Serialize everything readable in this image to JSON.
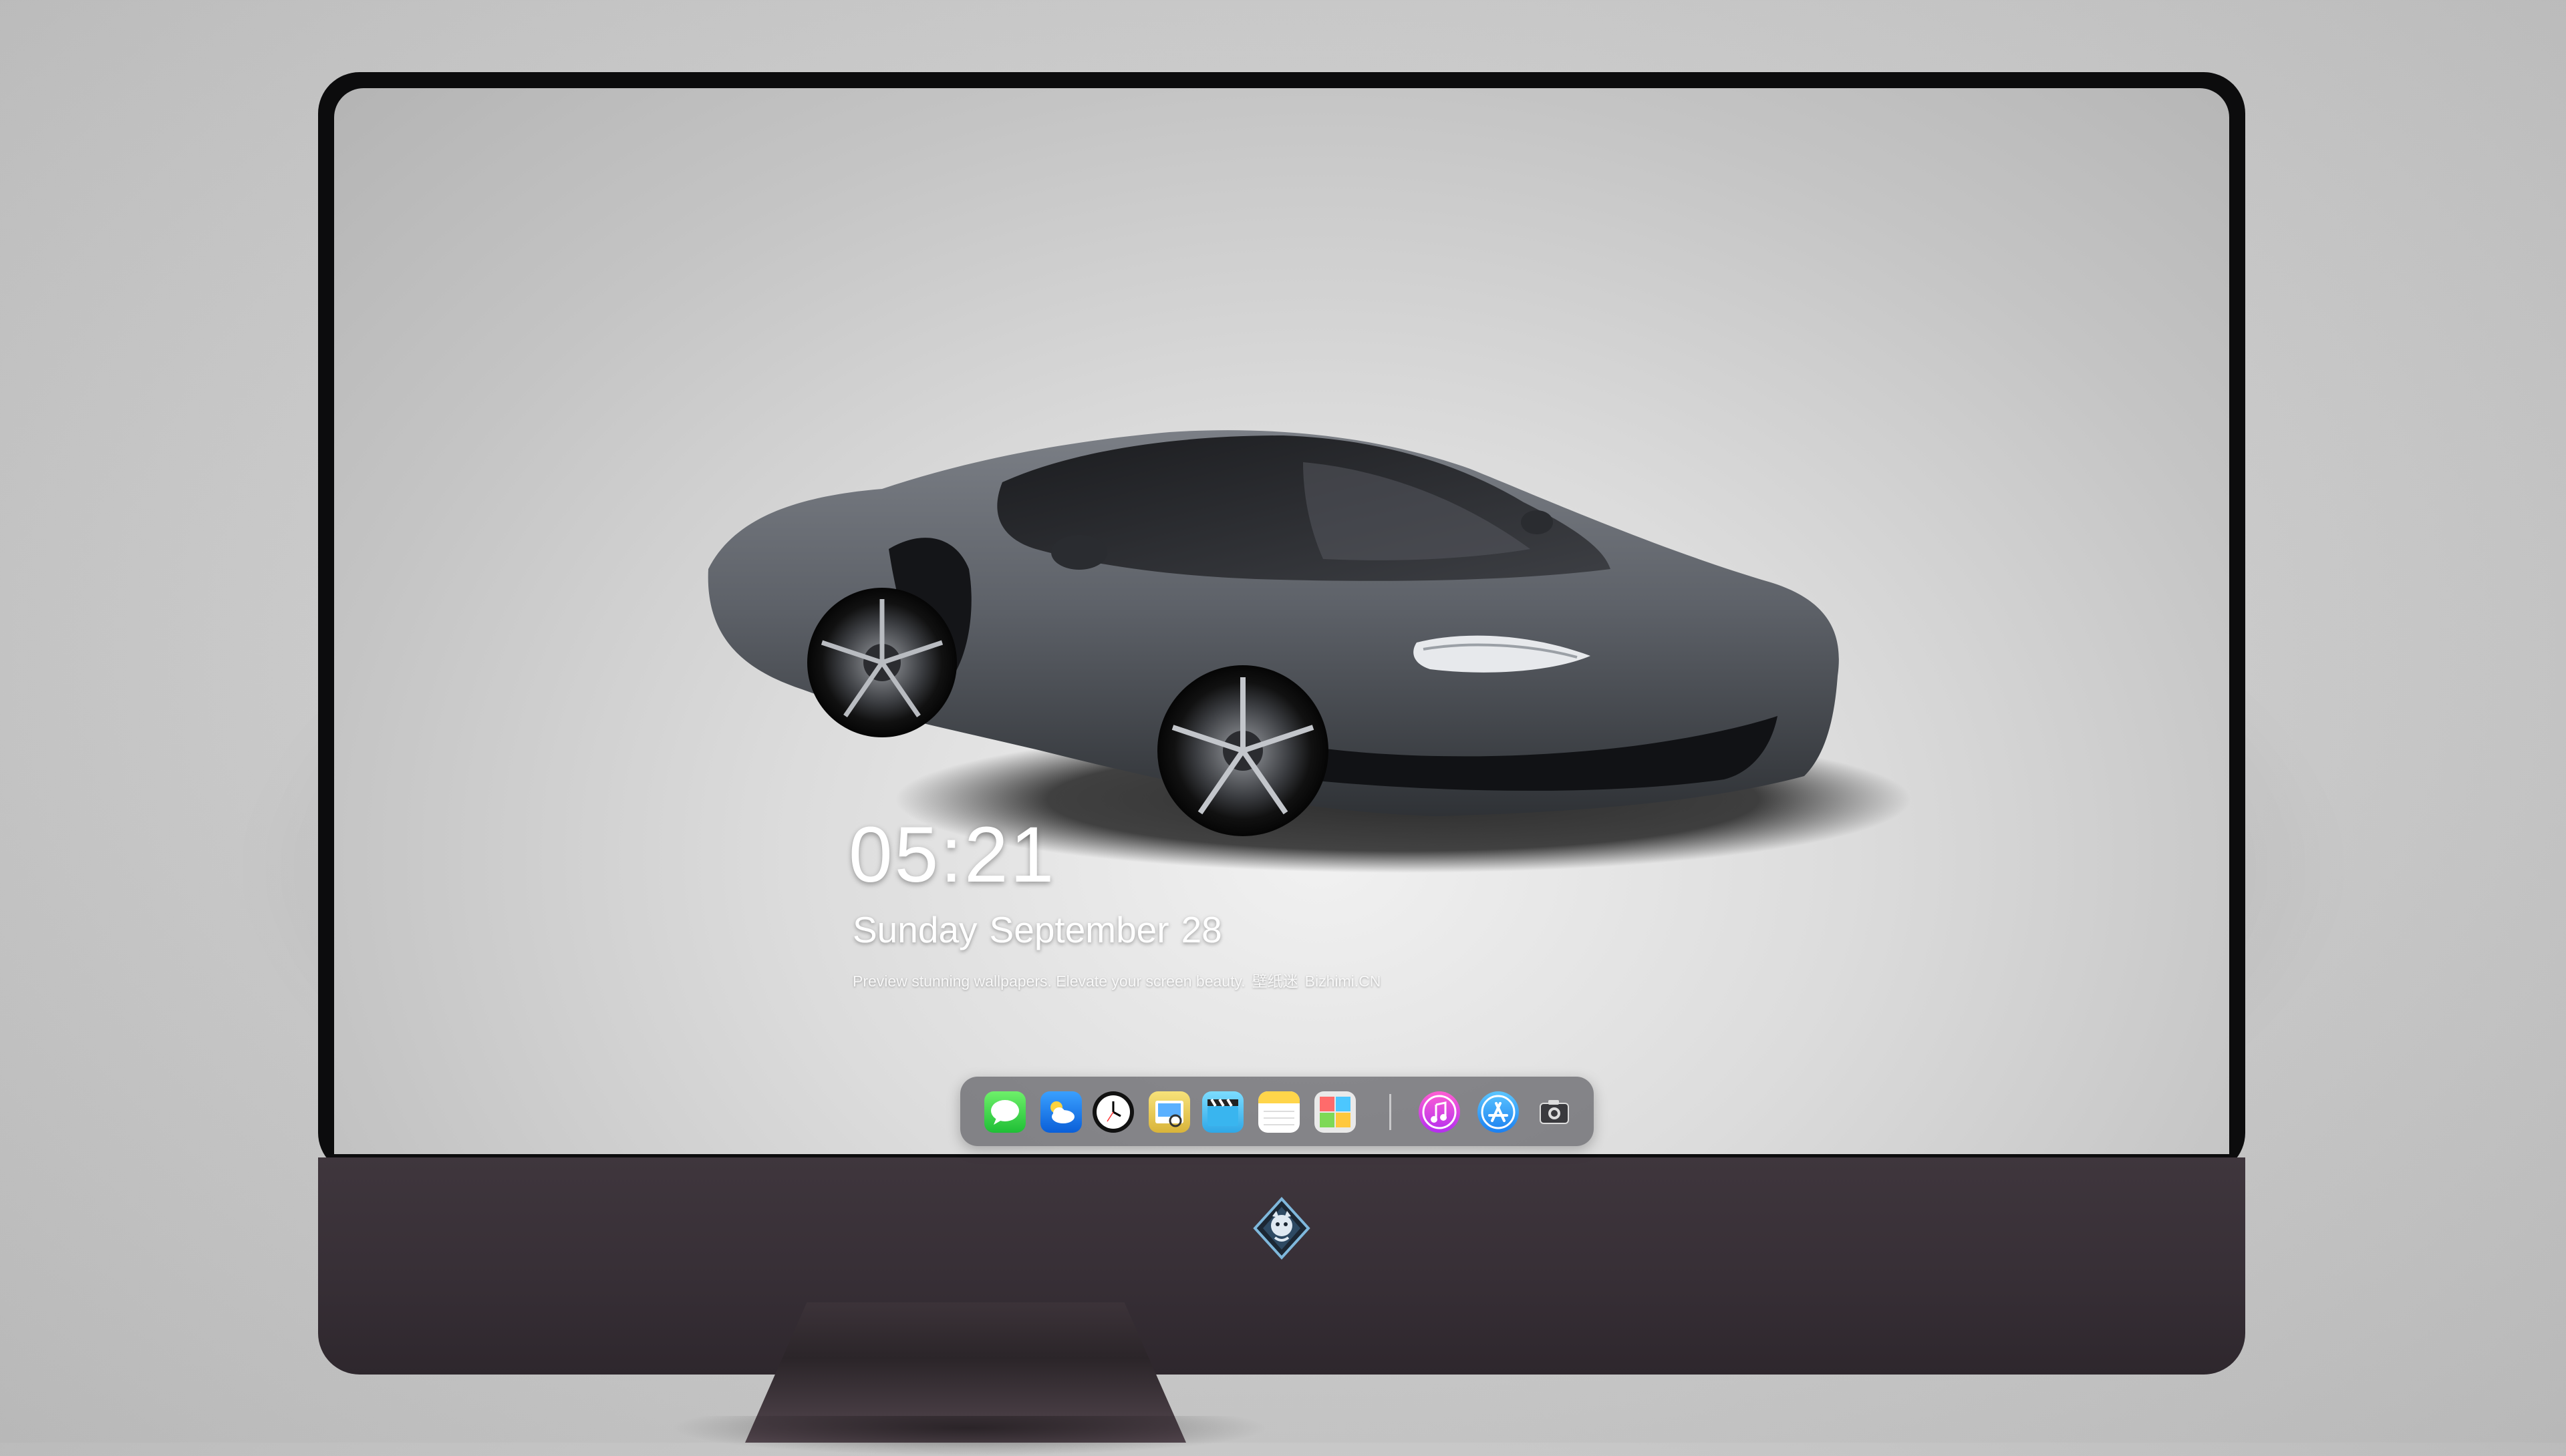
{
  "lock_screen": {
    "time": "05:21",
    "weekday": "Sunday",
    "month": "September",
    "day": "28",
    "tagline_en": "Preview stunning wallpapers. Elevate your screen beauty.",
    "tagline_cn": "壁纸迷",
    "tagline_site": "Bizhimi.CN"
  },
  "dock": {
    "apps": [
      {
        "name": "messages-icon"
      },
      {
        "name": "weather-icon"
      },
      {
        "name": "clock-icon"
      },
      {
        "name": "preview-icon"
      },
      {
        "name": "clips-icon"
      },
      {
        "name": "notes-icon"
      },
      {
        "name": "photo-booth-icon"
      },
      {
        "name": "itunes-icon"
      },
      {
        "name": "app-store-icon"
      },
      {
        "name": "camera-icon"
      }
    ]
  },
  "wallpaper": {
    "subject": "grey sports car",
    "car_color": "#5e6269"
  },
  "colors": {
    "bezel": "#0c0c0d",
    "chin": "#3a3138",
    "screen_bg": "#d4d4d4"
  }
}
